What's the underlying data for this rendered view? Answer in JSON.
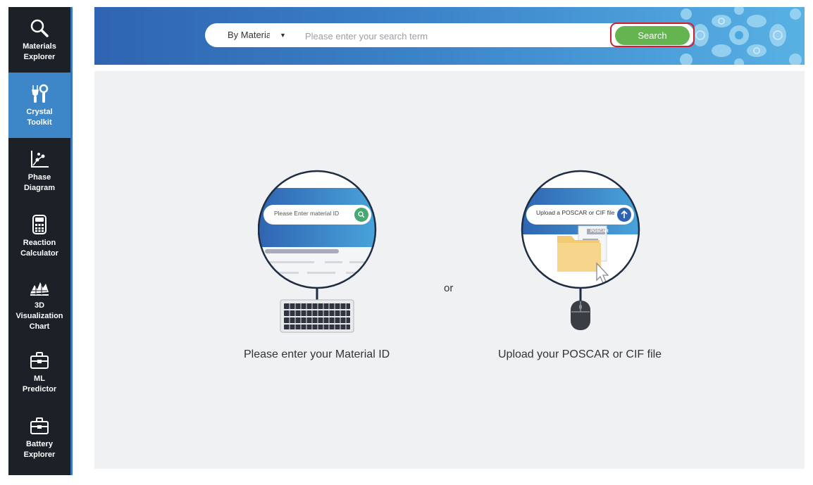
{
  "sidebar": {
    "items": [
      {
        "label": "Materials\nExplorer",
        "icon": "magnifier-icon",
        "active": false
      },
      {
        "label": "Crystal\nToolkit",
        "icon": "tools-icon",
        "active": true
      },
      {
        "label": "Phase\nDiagram",
        "icon": "phase-diagram-icon",
        "active": false
      },
      {
        "label": "Reaction\nCalculator",
        "icon": "calculator-icon",
        "active": false
      },
      {
        "label": "3D\nVisualization\nChart",
        "icon": "3d-chart-icon",
        "active": false
      },
      {
        "label": "ML\nPredictor",
        "icon": "toolbox-icon",
        "active": false
      },
      {
        "label": "Battery\nExplorer",
        "icon": "toolbox-icon",
        "active": false
      }
    ]
  },
  "header": {
    "search_mode": "By Materia",
    "search_placeholder": "Please enter your search term",
    "search_button": "Search"
  },
  "main": {
    "left_card": {
      "caption": "Please enter your Material ID",
      "inner_placeholder": "Please Enter material ID"
    },
    "or_text": "or",
    "right_card": {
      "caption": "Upload your POSCAR or CIF file",
      "inner_label": "Upload a POSCAR or CIF file",
      "file_tag": "POSCAR"
    }
  },
  "colors": {
    "sidebar_bg": "#1c2127",
    "active_nav": "#3d86c8",
    "search_button": "#64b550",
    "highlight": "#d11e2c",
    "main_bg": "#f0f1f2"
  }
}
